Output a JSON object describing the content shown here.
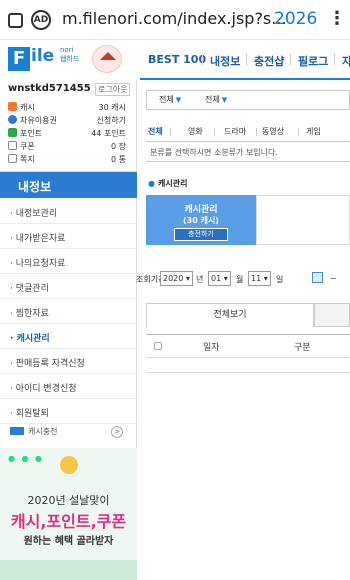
{
  "browser": {
    "ad_icon": "AD",
    "url": "m.filenori.com/index.jsp?s...",
    "tab_count": "2026",
    "menu_icon": "⋮"
  },
  "logo": {
    "letter": "F",
    "rest": "ile",
    "sub1": "nori",
    "sub2": "웹하드"
  },
  "topnav": [
    "BEST 100",
    "내정보",
    "충전샵",
    "필로그",
    "자"
  ],
  "user": {
    "name": "wnstkd571455",
    "logout": "로그아웃",
    "stats": [
      {
        "label": "캐시",
        "value": "30 캐시",
        "color": "#f0762b"
      },
      {
        "label": "자유이용권",
        "value": "신청하기",
        "color": "#2a7bd1"
      },
      {
        "label": "포인트",
        "value": "44 포인트",
        "color": "#2aa84a"
      },
      {
        "label": "쿠폰",
        "value": "0 장",
        "color": "#888888"
      },
      {
        "label": "쪽지",
        "value": "0 통",
        "color": "#888888"
      }
    ]
  },
  "menu": {
    "header": "내정보",
    "items": [
      "내정보관리",
      "내가받은자료",
      "나의요청자료",
      "댓글관리",
      "찜한자료",
      "캐시관리",
      "판매등록 자격신청",
      "아이디 변경신청",
      "회원탈퇴"
    ],
    "active_index": 5,
    "cash_label": "캐시충전",
    "cash_btn": ">"
  },
  "banner": {
    "line1": "2020년 설날맞이",
    "line2": "캐시,포인트,쿠폰",
    "line3": "원하는 혜택 골라받자"
  },
  "filters": {
    "select1": "전체",
    "select2": "전체",
    "genres": [
      "전체",
      "영화",
      "드라마",
      "동영상",
      "게임"
    ],
    "note": "분류를 선택하시면 소분류가 보입니다."
  },
  "section": {
    "title": "캐시관리",
    "box_title": "캐시관리",
    "box_amount": "(30 캐시)",
    "charge_btn": "충전하기"
  },
  "period": {
    "label": "조회기간",
    "year": "2020",
    "year_unit": "년",
    "month": "01",
    "month_unit": "월",
    "day": "11",
    "day_unit": "일",
    "dash": "~"
  },
  "table": {
    "tab": "전체보기",
    "col_date": "일자",
    "col_type": "구분"
  }
}
